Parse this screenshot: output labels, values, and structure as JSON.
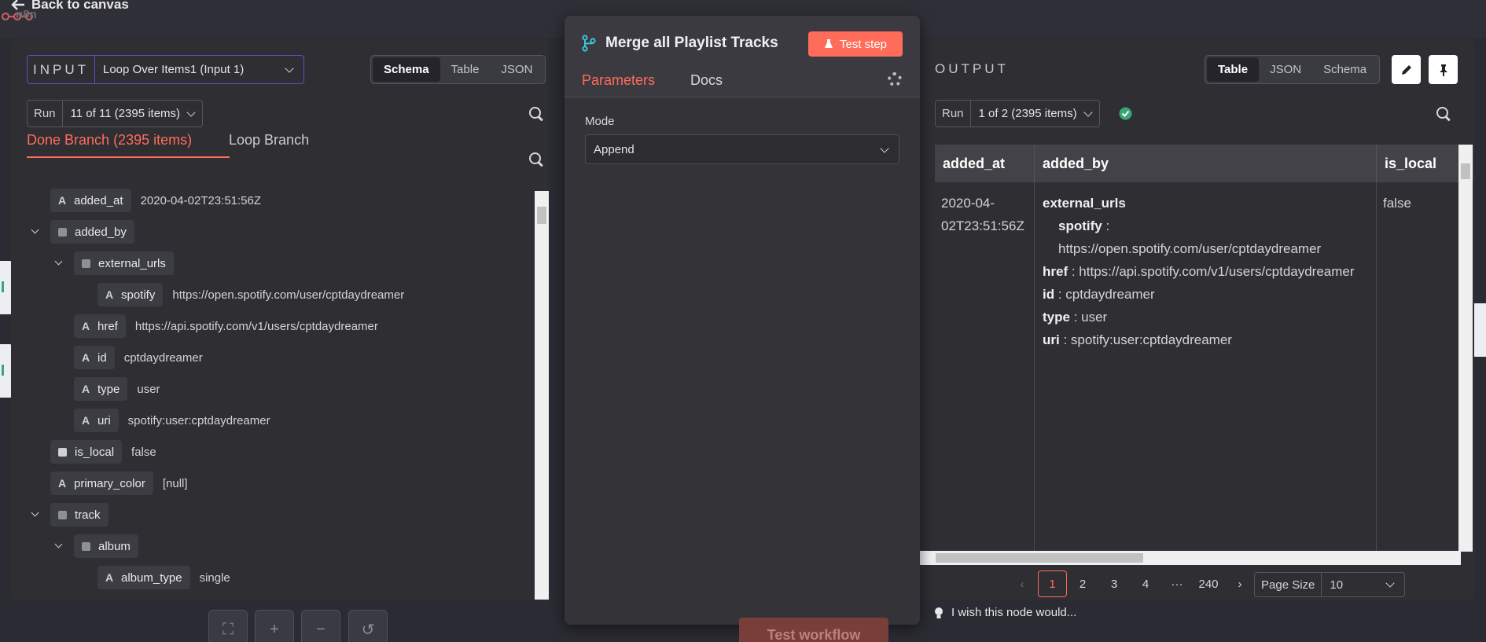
{
  "back_link": "Back to canvas",
  "brand": "n8n",
  "input": {
    "label": "INPUT",
    "source_select": "Loop Over Items1 (Input 1)",
    "view_modes": [
      "Schema",
      "Table",
      "JSON"
    ],
    "active_view": "Schema",
    "run_label": "Run",
    "run_value": "11 of 11 (2395 items)",
    "tabs": [
      "Done Branch (2395 items)",
      "Loop Branch"
    ],
    "tree": [
      {
        "key": "added_at",
        "type": "A",
        "value": "2020-04-02T23:51:56Z",
        "depth": 0
      },
      {
        "key": "added_by",
        "type": "obj",
        "value": "",
        "depth": 0
      },
      {
        "key": "external_urls",
        "type": "obj",
        "value": "",
        "depth": 1
      },
      {
        "key": "spotify",
        "type": "A",
        "value": "https://open.spotify.com/user/cptdaydreamer",
        "depth": 2
      },
      {
        "key": "href",
        "type": "A",
        "value": "https://api.spotify.com/v1/users/cptdaydreamer",
        "depth": 1
      },
      {
        "key": "id",
        "type": "A",
        "value": "cptdaydreamer",
        "depth": 1
      },
      {
        "key": "type",
        "type": "A",
        "value": "user",
        "depth": 1
      },
      {
        "key": "uri",
        "type": "A",
        "value": "spotify:user:cptdaydreamer",
        "depth": 1
      },
      {
        "key": "is_local",
        "type": "bool",
        "value": "false",
        "depth": 0
      },
      {
        "key": "primary_color",
        "type": "A",
        "value": "[null]",
        "depth": 0
      },
      {
        "key": "track",
        "type": "obj",
        "value": "",
        "depth": 0
      },
      {
        "key": "album",
        "type": "obj",
        "value": "",
        "depth": 1
      },
      {
        "key": "album_type",
        "type": "A",
        "value": "single",
        "depth": 2
      }
    ]
  },
  "node": {
    "title": "Merge all Playlist Tracks",
    "test_step": "Test step",
    "tabs": [
      "Parameters",
      "Docs"
    ],
    "mode_label": "Mode",
    "mode_value": "Append"
  },
  "output": {
    "label": "OUTPUT",
    "view_modes": [
      "Table",
      "JSON",
      "Schema"
    ],
    "active_view": "Table",
    "run_label": "Run",
    "run_value": "1 of 2 (2395 items)",
    "columns": [
      "added_at",
      "added_by",
      "is_local"
    ],
    "row": {
      "added_at": "2020-04-02T23:51:56Z",
      "added_by": {
        "external_urls_key": "external_urls",
        "spotify_key": "spotify",
        "spotify_val": "https://open.spotify.com/user/cptdaydreamer",
        "href_key": "href",
        "href_val": "https://api.spotify.com/v1/users/cptdaydreamer",
        "id_key": "id",
        "id_val": "cptdaydreamer",
        "type_key": "type",
        "type_val": "user",
        "uri_key": "uri",
        "uri_val": "spotify:user:cptdaydreamer"
      },
      "is_local": "false"
    },
    "pagination": [
      "1",
      "2",
      "3",
      "4",
      "···",
      "240"
    ],
    "page_size_label": "Page Size",
    "page_size_value": "10"
  },
  "canvas": {
    "test_workflow": "Test workflow",
    "wish": "I wish this node would..."
  },
  "colors": {
    "accent": "#ff6d5a",
    "success": "#3aa675",
    "input_border": "#5f4fbf"
  }
}
